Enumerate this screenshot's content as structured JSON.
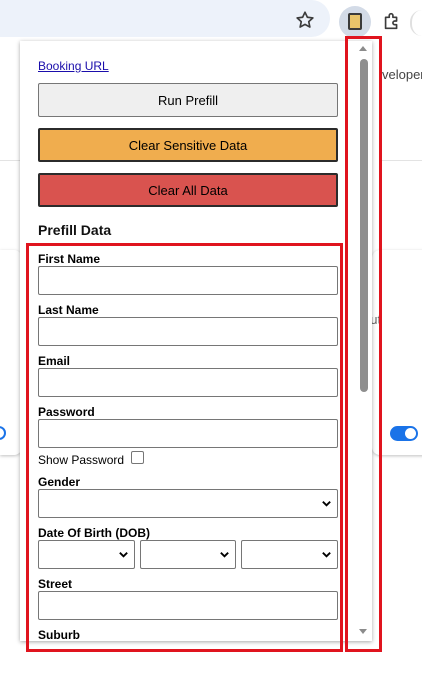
{
  "browser": {
    "star_icon": "star-icon",
    "extension_icon": "extension-icon",
    "puzzle_icon": "puzzle-icon"
  },
  "background_page": {
    "developer_text": "veloper m",
    "about_text": "out"
  },
  "popup": {
    "booking_link": "Booking URL",
    "run_prefill_label": "Run Prefill",
    "clear_sensitive_label": "Clear Sensitive Data",
    "clear_all_label": "Clear All Data",
    "section_title": "Prefill Data",
    "fields": {
      "first_name": "First Name",
      "last_name": "Last Name",
      "email": "Email",
      "password": "Password",
      "show_password": "Show Password",
      "gender": "Gender",
      "dob": "Date Of Birth (DOB)",
      "street": "Street",
      "suburb": "Suburb"
    }
  },
  "colors": {
    "clear_sensitive": "#f0ad4e",
    "clear_all": "#d9534f",
    "link": "#1a0dab",
    "highlight": "#e0141e",
    "toggle": "#1a73e8"
  }
}
